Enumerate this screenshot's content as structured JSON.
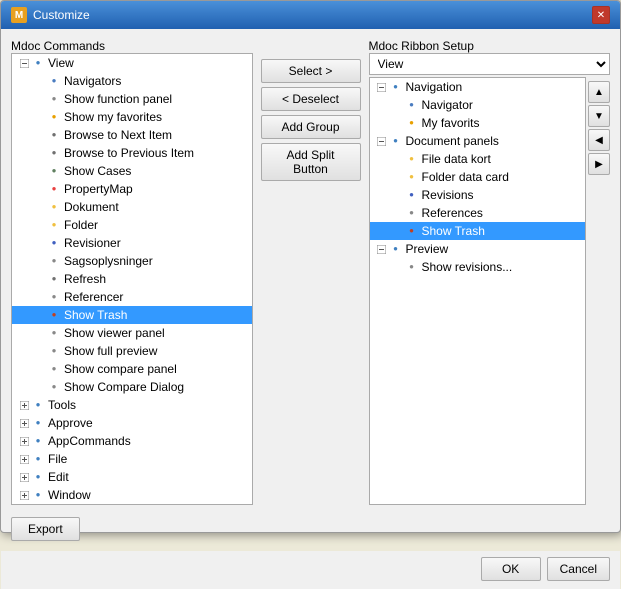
{
  "dialog": {
    "title": "Customize",
    "title_icon": "M",
    "close_label": "✕"
  },
  "left_panel": {
    "label": "Mdoc Commands",
    "items": [
      {
        "id": "view-root",
        "indent": 0,
        "expand": "−",
        "icon": "🔧",
        "icon_class": "ico-tools",
        "label": "View",
        "selected": false
      },
      {
        "id": "navigators",
        "indent": 1,
        "expand": "",
        "icon": "⊘",
        "icon_class": "ico-nav",
        "label": "Navigators",
        "selected": false
      },
      {
        "id": "show-func",
        "indent": 1,
        "expand": "",
        "icon": "▤",
        "icon_class": "ico-func",
        "label": "Show function panel",
        "selected": false
      },
      {
        "id": "show-fav",
        "indent": 1,
        "expand": "",
        "icon": "☰",
        "icon_class": "ico-fav",
        "label": "Show my favorites",
        "selected": false
      },
      {
        "id": "browse-next",
        "indent": 1,
        "expand": "",
        "icon": "←",
        "icon_class": "ico-browse",
        "label": "Browse to Next Item",
        "selected": false
      },
      {
        "id": "browse-prev",
        "indent": 1,
        "expand": "",
        "icon": "→",
        "icon_class": "ico-browse",
        "label": "Browse to Previous Item",
        "selected": false
      },
      {
        "id": "show-cases",
        "indent": 1,
        "expand": "",
        "icon": "▦",
        "icon_class": "ico-cases",
        "label": "Show Cases",
        "selected": false
      },
      {
        "id": "propertymap",
        "indent": 1,
        "expand": "",
        "icon": "★",
        "icon_class": "ico-prop",
        "label": "PropertyMap",
        "selected": false
      },
      {
        "id": "dokument",
        "indent": 1,
        "expand": "",
        "icon": "📄",
        "icon_class": "ico-doc",
        "label": "Dokument",
        "selected": false
      },
      {
        "id": "folder",
        "indent": 1,
        "expand": "",
        "icon": "📁",
        "icon_class": "ico-folder",
        "label": "Folder",
        "selected": false
      },
      {
        "id": "revisioner",
        "indent": 1,
        "expand": "",
        "icon": "🔄",
        "icon_class": "ico-rev",
        "label": "Revisioner",
        "selected": false
      },
      {
        "id": "sagsoplysninger",
        "indent": 1,
        "expand": "",
        "icon": "🔧",
        "icon_class": "ico-sag",
        "label": "Sagsoplysninger",
        "selected": false
      },
      {
        "id": "refresh",
        "indent": 1,
        "expand": "",
        "icon": "↺",
        "icon_class": "ico-browse",
        "label": "Refresh",
        "selected": false
      },
      {
        "id": "referencer",
        "indent": 1,
        "expand": "",
        "icon": "🔗",
        "icon_class": "ico-ref",
        "label": "Referencer",
        "selected": false
      },
      {
        "id": "show-trash-left",
        "indent": 1,
        "expand": "",
        "icon": "🗑",
        "icon_class": "ico-trash",
        "label": "Show Trash",
        "selected": true
      },
      {
        "id": "show-viewer",
        "indent": 1,
        "expand": "",
        "icon": "👁",
        "icon_class": "ico-view",
        "label": "Show viewer panel",
        "selected": false
      },
      {
        "id": "show-full",
        "indent": 1,
        "expand": "",
        "icon": "⊞",
        "icon_class": "ico-view",
        "label": "Show full preview",
        "selected": false
      },
      {
        "id": "show-compare",
        "indent": 1,
        "expand": "",
        "icon": "⊟",
        "icon_class": "ico-compare",
        "label": "Show compare panel",
        "selected": false
      },
      {
        "id": "show-compare-dialog",
        "indent": 1,
        "expand": "",
        "icon": "⊡",
        "icon_class": "ico-compare",
        "label": "Show Compare Dialog",
        "selected": false
      },
      {
        "id": "tools-root",
        "indent": 0,
        "expand": "+",
        "icon": "🔧",
        "icon_class": "ico-tools",
        "label": "Tools",
        "selected": false
      },
      {
        "id": "approve-root",
        "indent": 0,
        "expand": "+",
        "icon": "🔧",
        "icon_class": "ico-approve",
        "label": "Approve",
        "selected": false
      },
      {
        "id": "appcommands-root",
        "indent": 0,
        "expand": "+",
        "icon": "🔧",
        "icon_class": "ico-app",
        "label": "AppCommands",
        "selected": false
      },
      {
        "id": "file-root",
        "indent": 0,
        "expand": "+",
        "icon": "🔧",
        "icon_class": "ico-file",
        "label": "File",
        "selected": false
      },
      {
        "id": "edit-root",
        "indent": 0,
        "expand": "+",
        "icon": "🔧",
        "icon_class": "ico-edit",
        "label": "Edit",
        "selected": false
      },
      {
        "id": "window-root",
        "indent": 0,
        "expand": "+",
        "icon": "🔧",
        "icon_class": "ico-win",
        "label": "Window",
        "selected": false
      }
    ]
  },
  "middle_panel": {
    "select_label": "Select >",
    "deselect_label": "< Deselect",
    "add_group_label": "Add Group",
    "add_split_label": "Add Split Button"
  },
  "right_panel": {
    "label": "Mdoc Ribbon Setup",
    "dropdown_value": "View",
    "items": [
      {
        "id": "navigation-group",
        "indent": 0,
        "expand": "−",
        "icon": "🔧",
        "icon_class": "ico-tools",
        "label": "Navigation",
        "selected": false
      },
      {
        "id": "navigator-r",
        "indent": 1,
        "expand": "",
        "icon": "⊘",
        "icon_class": "ico-nav",
        "label": "Navigator",
        "selected": false
      },
      {
        "id": "my-fav-r",
        "indent": 1,
        "expand": "",
        "icon": "☰",
        "icon_class": "ico-fav",
        "label": "My favorits",
        "selected": false
      },
      {
        "id": "doc-panels-group",
        "indent": 0,
        "expand": "−",
        "icon": "🔧",
        "icon_class": "ico-tools",
        "label": "Document panels",
        "selected": false
      },
      {
        "id": "file-data-kort",
        "indent": 1,
        "expand": "",
        "icon": "📁",
        "icon_class": "ico-folder",
        "label": "File data kort",
        "selected": false
      },
      {
        "id": "folder-data-card",
        "indent": 1,
        "expand": "",
        "icon": "📁",
        "icon_class": "ico-folder",
        "label": "Folder data card",
        "selected": false
      },
      {
        "id": "revisions-r",
        "indent": 1,
        "expand": "",
        "icon": "🔄",
        "icon_class": "ico-rev",
        "label": "Revisions",
        "selected": false
      },
      {
        "id": "references-r",
        "indent": 1,
        "expand": "",
        "icon": "🔗",
        "icon_class": "ico-ref",
        "label": "References",
        "selected": false
      },
      {
        "id": "show-trash-r",
        "indent": 1,
        "expand": "",
        "icon": "🗑",
        "icon_class": "ico-trash",
        "label": "Show Trash",
        "selected": true
      },
      {
        "id": "preview-group",
        "indent": 0,
        "expand": "−",
        "icon": "🔧",
        "icon_class": "ico-tools",
        "label": "Preview",
        "selected": false
      },
      {
        "id": "show-revisions-r",
        "indent": 1,
        "expand": "",
        "icon": "🏠",
        "icon_class": "ico-view",
        "label": "Show revisions...",
        "selected": false
      }
    ]
  },
  "footer": {
    "export_label": "Export",
    "ok_label": "OK",
    "cancel_label": "Cancel"
  }
}
